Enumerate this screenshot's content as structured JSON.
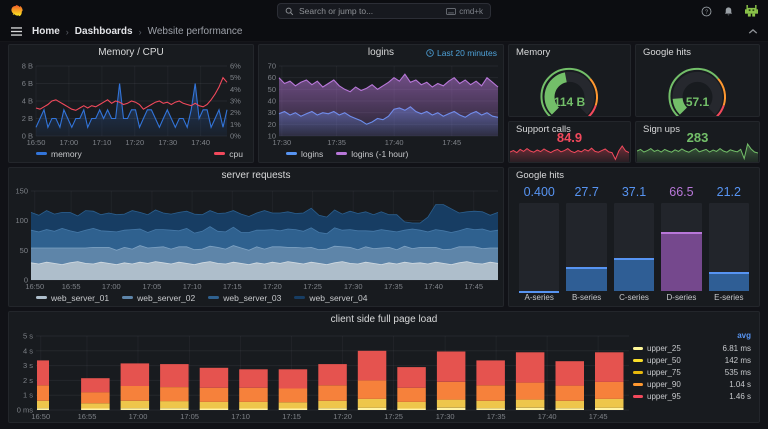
{
  "colors": {
    "blue": "#3274D9",
    "light_blue": "#5794F2",
    "red": "#F2495C",
    "green": "#73BF69",
    "purple": "#B877D9",
    "orange": "#FF9830",
    "yellow": "#FADE2A",
    "panel_bg": "#181B1F",
    "page_bg": "#111217"
  },
  "icons": {
    "grafana-logo": "flame",
    "search-icon": "magnifier",
    "keyboard-icon": "kbd",
    "help-icon": "question-circle",
    "bell-icon": "notifications",
    "avatar": "pixel-monster",
    "menu-icon": "hamburger",
    "chevron-right-icon": "breadcrumb-sep",
    "chevron-up-icon": "collapse",
    "clock-icon": "time-range"
  },
  "topnav": {
    "search_placeholder": "Search or jump to...",
    "search_shortcut": "cmd+k",
    "breadcrumb": [
      {
        "label": "Home"
      },
      {
        "label": "Dashboards"
      },
      {
        "label": "Website performance"
      }
    ]
  },
  "panels": {
    "memory_cpu": {
      "title": "Memory / CPU"
    },
    "logins": {
      "title": "logins",
      "time_badge": "Last 20 minutes"
    },
    "memory_gauge": {
      "title": "Memory",
      "value": "114 B"
    },
    "google_gauge": {
      "title": "Google hits",
      "value": "57.1"
    },
    "support_calls": {
      "title": "Support calls",
      "value": "84.9"
    },
    "sign_ups": {
      "title": "Sign ups",
      "value": "283"
    },
    "server_requests": {
      "title": "server requests"
    },
    "google_hits_bars": {
      "title": "Google hits"
    },
    "client_load": {
      "title": "client side full page load"
    }
  },
  "chart_data": [
    {
      "id": "mem_cpu",
      "type": "timeseries",
      "title": "Memory / CPU",
      "ylim": [
        0,
        8
      ],
      "y2lim": [
        0,
        6
      ],
      "y_ticks": [
        {
          "l": "0 B",
          "v": 0
        },
        {
          "l": "2 B",
          "v": 2
        },
        {
          "l": "4 B",
          "v": 4
        },
        {
          "l": "6 B",
          "v": 6
        },
        {
          "l": "8 B",
          "v": 8
        }
      ],
      "y2_ticks": [
        {
          "l": "0%",
          "v": 0
        },
        {
          "l": "1%",
          "v": 1
        },
        {
          "l": "2%",
          "v": 2
        },
        {
          "l": "3%",
          "v": 3
        },
        {
          "l": "4%",
          "v": 4
        },
        {
          "l": "5%",
          "v": 5
        },
        {
          "l": "6%",
          "v": 6
        }
      ],
      "x_ticks": [
        {
          "l": "16:50",
          "f": 0
        },
        {
          "l": "17:00",
          "f": 0.172
        },
        {
          "l": "17:10",
          "f": 0.345
        },
        {
          "l": "17:20",
          "f": 0.517
        },
        {
          "l": "17:30",
          "f": 0.69
        },
        {
          "l": "17:40",
          "f": 0.862
        }
      ],
      "series": [
        {
          "name": "memory",
          "color": "#3274D9",
          "axis": "left",
          "fill": [
            0.4,
            0.06
          ],
          "vals": [
            1,
            2,
            3,
            1,
            2,
            2,
            1,
            3,
            2,
            1,
            2,
            2,
            3,
            1,
            2,
            2,
            3,
            2,
            3,
            2,
            2,
            6,
            2,
            2,
            3,
            3,
            1,
            2,
            3,
            3,
            2,
            1,
            2,
            3,
            2,
            1,
            2,
            2,
            1,
            3,
            6,
            2,
            3,
            3,
            1,
            2,
            3,
            1,
            3
          ]
        },
        {
          "name": "cpu",
          "color": "#F2495C",
          "axis": "right",
          "fill": null,
          "vals": [
            2.4,
            2.3,
            2.5,
            2.7,
            3.0,
            3.1,
            2.9,
            2.7,
            2.5,
            2.3,
            2.2,
            2.4,
            2.6,
            2.4,
            2.6,
            2.5,
            2.7,
            2.9,
            3.1,
            2.8,
            3.0,
            2.9,
            2.7,
            2.8,
            3.0,
            2.9,
            2.7,
            2.3,
            2.5,
            2.7,
            2.9,
            3.0,
            2.8,
            2.9,
            2.7,
            2.9,
            3.0,
            2.8,
            2.7,
            2.6,
            2.8,
            2.6,
            2.5,
            2.7,
            3.1,
            3.6,
            4.2,
            5.0,
            4.6
          ]
        }
      ]
    },
    {
      "id": "logins",
      "type": "timeseries",
      "title": "logins",
      "ylim": [
        10,
        70
      ],
      "y_ticks": [
        {
          "l": "10",
          "v": 10
        },
        {
          "l": "20",
          "v": 20
        },
        {
          "l": "30",
          "v": 30
        },
        {
          "l": "40",
          "v": 40
        },
        {
          "l": "50",
          "v": 50
        },
        {
          "l": "60",
          "v": 60
        },
        {
          "l": "70",
          "v": 70
        }
      ],
      "x_ticks": [
        {
          "l": "17:30",
          "f": 0.013
        },
        {
          "l": "17:35",
          "f": 0.263
        },
        {
          "l": "17:40",
          "f": 0.526
        },
        {
          "l": "17:45",
          "f": 0.789
        }
      ],
      "series": [
        {
          "name": "logins",
          "color": "#5794F2",
          "axis": "left",
          "fill": [
            0.45,
            0.08
          ],
          "vals": [
            29,
            31,
            28,
            30,
            27,
            29,
            31,
            28,
            30,
            29,
            31,
            28,
            30,
            27,
            25,
            23,
            20,
            22,
            25,
            24,
            27,
            33,
            34,
            32,
            35,
            31,
            29,
            31,
            28,
            30,
            27,
            29,
            31,
            28,
            26,
            29,
            31,
            28,
            30,
            27,
            26
          ]
        },
        {
          "name": "logins (-1 hour)",
          "color": "#B877D9",
          "axis": "left",
          "fill": [
            0.55,
            0.1
          ],
          "vals": [
            60,
            55,
            57,
            53,
            56,
            58,
            54,
            57,
            52,
            55,
            58,
            53,
            50,
            48,
            52,
            49,
            51,
            54,
            50,
            53,
            56,
            60,
            57,
            63,
            56,
            58,
            54,
            56,
            52,
            55,
            53,
            57,
            60,
            55,
            58,
            54,
            57,
            53,
            60,
            56,
            52
          ]
        }
      ]
    },
    {
      "id": "memory_gauge",
      "type": "gauge",
      "value": "114 B",
      "fraction": 0.46,
      "color": "#73BF69",
      "thresholds": [
        {
          "f": 0,
          "c": "#73BF69"
        },
        {
          "f": 0.68,
          "c": "#FF9830"
        },
        {
          "f": 0.9,
          "c": "#F2495C"
        }
      ]
    },
    {
      "id": "google_gauge",
      "type": "gauge",
      "value": "57.1",
      "fraction": 0.15,
      "color": "#73BF69",
      "thresholds": [
        {
          "f": 0,
          "c": "#73BF69"
        },
        {
          "f": 0.68,
          "c": "#FF9830"
        },
        {
          "f": 0.9,
          "c": "#F2495C"
        }
      ]
    },
    {
      "id": "support_spark",
      "type": "sparkline",
      "color": "#F2495C",
      "vals": [
        0.45,
        0.52,
        0.42,
        0.58,
        0.48,
        0.62,
        0.5,
        0.44,
        0.55,
        0.47,
        0.6,
        0.5,
        0.42,
        0.52,
        0.58,
        0.46,
        0.52,
        0.62,
        0.48,
        0.42,
        0.52,
        0.46,
        0.58,
        0.5,
        0.64,
        0.48,
        0.44,
        0.52,
        0.6,
        0.46,
        0.42,
        0.08,
        0.5,
        0.75,
        0.5,
        0.42
      ]
    },
    {
      "id": "signups_spark",
      "type": "sparkline",
      "color": "#73BF69",
      "vals": [
        0.5,
        0.58,
        0.45,
        0.52,
        0.62,
        0.48,
        0.55,
        0.45,
        0.58,
        0.5,
        0.44,
        0.56,
        0.48,
        0.6,
        0.5,
        0.44,
        0.54,
        0.62,
        0.46,
        0.52,
        0.58,
        0.45,
        0.55,
        0.48,
        0.62,
        0.5,
        0.44,
        0.56,
        0.5,
        0.46,
        0.58,
        0.12,
        0.85,
        0.6,
        0.45,
        0.4
      ]
    },
    {
      "id": "server_requests",
      "type": "stacked-area",
      "title": "server requests",
      "ylim": [
        0,
        150
      ],
      "stacked": true,
      "y_ticks": [
        {
          "l": "0",
          "v": 0
        },
        {
          "l": "50",
          "v": 50
        },
        {
          "l": "100",
          "v": 100
        },
        {
          "l": "150",
          "v": 150
        }
      ],
      "x_ticks": [
        {
          "l": "16:50",
          "f": 0.008
        },
        {
          "l": "16:55",
          "f": 0.086
        },
        {
          "l": "17:00",
          "f": 0.172
        },
        {
          "l": "17:05",
          "f": 0.259
        },
        {
          "l": "17:10",
          "f": 0.345
        },
        {
          "l": "17:15",
          "f": 0.431
        },
        {
          "l": "17:20",
          "f": 0.517
        },
        {
          "l": "17:25",
          "f": 0.603
        },
        {
          "l": "17:30",
          "f": 0.69
        },
        {
          "l": "17:35",
          "f": 0.776
        },
        {
          "l": "17:40",
          "f": 0.862
        },
        {
          "l": "17:45",
          "f": 0.948
        }
      ],
      "series": [
        {
          "name": "web_server_01",
          "fill": "#AEBECB",
          "line": "#D2DBE2",
          "vals": [
            29,
            27,
            30,
            28,
            26,
            29,
            31,
            28,
            27,
            30,
            28,
            26,
            29,
            27,
            30,
            28,
            31,
            29,
            27,
            30,
            28,
            26,
            29,
            31,
            28,
            27,
            30,
            28,
            26,
            29,
            27,
            30,
            28,
            31,
            29,
            27,
            30,
            28,
            26,
            29,
            31,
            28,
            27,
            30,
            28,
            26,
            29,
            27,
            30,
            28,
            29,
            27,
            30,
            28,
            26,
            29,
            31,
            28,
            27,
            30,
            28
          ]
        },
        {
          "name": "web_server_02",
          "fill": "#5E85A9",
          "line": "#7FA3C4",
          "vals": [
            25,
            27,
            24,
            26,
            28,
            25,
            23,
            26,
            28,
            25,
            27,
            24,
            26,
            25,
            28,
            26,
            24,
            27,
            25,
            26,
            28,
            25,
            23,
            26,
            27,
            25,
            28,
            26,
            24,
            27,
            25,
            26,
            28,
            24,
            26,
            27,
            25,
            23,
            26,
            28,
            25,
            27,
            24,
            26,
            25,
            28,
            26,
            24,
            27,
            25,
            26,
            28,
            25,
            23,
            26,
            27,
            25,
            28,
            26,
            24,
            26
          ]
        },
        {
          "name": "web_server_03",
          "fill": "#2F618F",
          "line": "#4679A8",
          "vals": [
            30,
            27,
            31,
            28,
            33,
            29,
            26,
            30,
            32,
            28,
            27,
            31,
            29,
            33,
            28,
            26,
            30,
            29,
            32,
            27,
            31,
            28,
            30,
            33,
            27,
            29,
            31,
            26,
            30,
            28,
            32,
            29,
            27,
            31,
            30,
            28,
            33,
            29,
            26,
            31,
            28,
            30,
            32,
            27,
            29,
            31,
            28,
            30,
            27,
            33,
            29,
            26,
            30,
            32,
            28,
            27,
            31,
            29,
            33,
            28,
            30
          ]
        },
        {
          "name": "web_server_04",
          "fill": "#173D63",
          "line": "#2B5F8E",
          "vals": [
            30,
            28,
            32,
            29,
            27,
            31,
            28,
            33,
            29,
            27,
            31,
            29,
            27,
            32,
            28,
            30,
            33,
            28,
            27,
            31,
            29,
            32,
            28,
            27,
            30,
            32,
            28,
            31,
            27,
            29,
            33,
            28,
            30,
            29,
            27,
            31,
            33,
            29,
            28,
            30,
            27,
            31,
            29,
            32,
            28,
            30,
            27,
            29,
            14,
            10,
            12,
            25,
            42,
            44,
            40,
            30,
            28,
            31,
            29,
            27,
            30
          ]
        }
      ]
    },
    {
      "id": "google_bars",
      "type": "bargauge",
      "title": "Google hits",
      "max": 100,
      "categories": [
        "A-series",
        "B-series",
        "C-series",
        "D-series",
        "E-series"
      ],
      "values": [
        0.4,
        27.7,
        37.1,
        66.5,
        21.2
      ],
      "labels": [
        "0.400",
        "27.7",
        "37.1",
        "66.5",
        "21.2"
      ],
      "value_colors": [
        "#5794F2",
        "#5794F2",
        "#5794F2",
        "#B877D9",
        "#5794F2"
      ],
      "fill_colors": [
        "#2F5E95",
        "#2F5E95",
        "#2F5E95",
        "#75488D",
        "#2F5E95"
      ],
      "cap_colors": [
        "#5794F2",
        "#5794F2",
        "#5794F2",
        "#B877D9",
        "#5794F2"
      ]
    },
    {
      "id": "client_load",
      "type": "stacked-bar",
      "title": "client side full page load",
      "ylim": [
        0,
        5
      ],
      "y_ticks": [
        {
          "l": "0 ms",
          "v": 0
        },
        {
          "l": "1 s",
          "v": 1
        },
        {
          "l": "2 s",
          "v": 2
        },
        {
          "l": "3 s",
          "v": 3
        },
        {
          "l": "4 s",
          "v": 4
        },
        {
          "l": "5 s",
          "v": 5
        }
      ],
      "x_ticks": [
        {
          "l": "16:50",
          "f": 0.008
        },
        {
          "l": "16:55",
          "f": 0.086
        },
        {
          "l": "17:00",
          "f": 0.172
        },
        {
          "l": "17:05",
          "f": 0.259
        },
        {
          "l": "17:10",
          "f": 0.345
        },
        {
          "l": "17:15",
          "f": 0.431
        },
        {
          "l": "17:20",
          "f": 0.517
        },
        {
          "l": "17:25",
          "f": 0.603
        },
        {
          "l": "17:30",
          "f": 0.69
        },
        {
          "l": "17:35",
          "f": 0.776
        },
        {
          "l": "17:40",
          "f": 0.862
        },
        {
          "l": "17:45",
          "f": 0.948
        }
      ],
      "seg_colors": [
        "#FFF3A6",
        "#EEC64B",
        "#F6813B",
        "#E5534F"
      ],
      "bars": [
        [
          0.12,
          0.5,
          1.05,
          1.68
        ],
        [
          0.1,
          0.35,
          0.75,
          0.95
        ],
        [
          0.12,
          0.5,
          1.0,
          1.53
        ],
        [
          0.12,
          0.48,
          0.95,
          1.55
        ],
        [
          0.1,
          0.45,
          0.95,
          1.35
        ],
        [
          0.1,
          0.45,
          0.95,
          1.25
        ],
        [
          0.1,
          0.42,
          0.93,
          1.3
        ],
        [
          0.12,
          0.5,
          1.05,
          1.43
        ],
        [
          0.15,
          0.6,
          1.25,
          2.0
        ],
        [
          0.1,
          0.45,
          0.95,
          1.4
        ],
        [
          0.15,
          0.55,
          1.2,
          2.05
        ],
        [
          0.12,
          0.5,
          1.05,
          1.68
        ],
        [
          0.15,
          0.55,
          1.15,
          2.05
        ],
        [
          0.12,
          0.5,
          1.03,
          1.65
        ],
        [
          0.15,
          0.6,
          1.15,
          2.0
        ]
      ],
      "legend": {
        "header": "avg",
        "entries": [
          {
            "name": "upper_25",
            "value": "6.81 ms",
            "color": "#FFF899"
          },
          {
            "name": "upper_50",
            "value": "142 ms",
            "color": "#FADE2A"
          },
          {
            "name": "upper_75",
            "value": "535 ms",
            "color": "#E8B80C"
          },
          {
            "name": "upper_90",
            "value": "1.04 s",
            "color": "#FF9830"
          },
          {
            "name": "upper_95",
            "value": "1.46 s",
            "color": "#F2495C"
          }
        ]
      }
    }
  ]
}
